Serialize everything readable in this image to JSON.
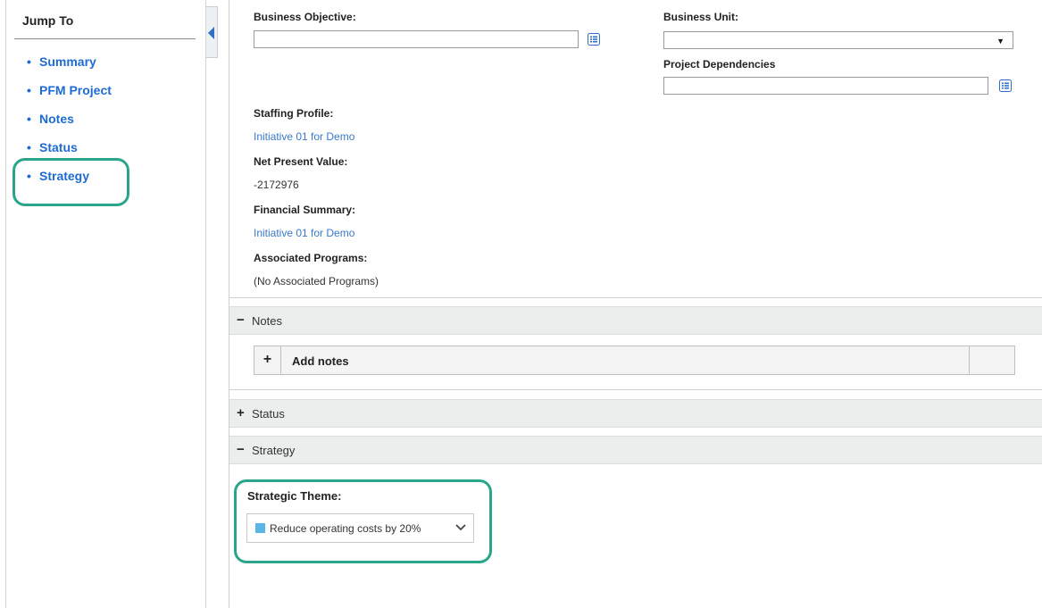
{
  "sidebar": {
    "title": "Jump To",
    "bullet": "•",
    "items": [
      {
        "label": "Summary"
      },
      {
        "label": "PFM Project"
      },
      {
        "label": "Notes"
      },
      {
        "label": "Status"
      },
      {
        "label": "Strategy"
      }
    ]
  },
  "fields": {
    "business_objective": {
      "label": "Business Objective:",
      "value": ""
    },
    "business_unit": {
      "label": "Business Unit:",
      "value": ""
    },
    "project_dependencies": {
      "label": "Project Dependencies",
      "value": ""
    },
    "staffing_profile": {
      "label": "Staffing Profile:",
      "value": "Initiative 01 for Demo"
    },
    "net_present_value": {
      "label": "Net Present Value:",
      "value": "-2172976"
    },
    "financial_summary": {
      "label": "Financial Summary:",
      "value": "Initiative 01 for Demo"
    },
    "associated_programs": {
      "label": "Associated Programs:",
      "value": "(No Associated Programs)"
    }
  },
  "sections": {
    "notes": {
      "symbol": "−",
      "title": "Notes",
      "add_symbol": "+",
      "add_label": "Add notes"
    },
    "status": {
      "symbol": "+",
      "title": "Status"
    },
    "strategy": {
      "symbol": "−",
      "title": "Strategy"
    }
  },
  "strategy": {
    "theme_label": "Strategic Theme:",
    "theme_value": "Reduce operating costs by 20%",
    "theme_color": "#5bb5e8"
  },
  "colors": {
    "link": "#1f6bd1",
    "highlight": "#2aa58a",
    "icon_blue": "#2f6fc5"
  },
  "icons": {
    "collapse": "chevron-left-icon",
    "list_picker": "list-icon",
    "dropdown": "triangle-down-icon",
    "theme_dropdown": "chevron-down-icon"
  }
}
